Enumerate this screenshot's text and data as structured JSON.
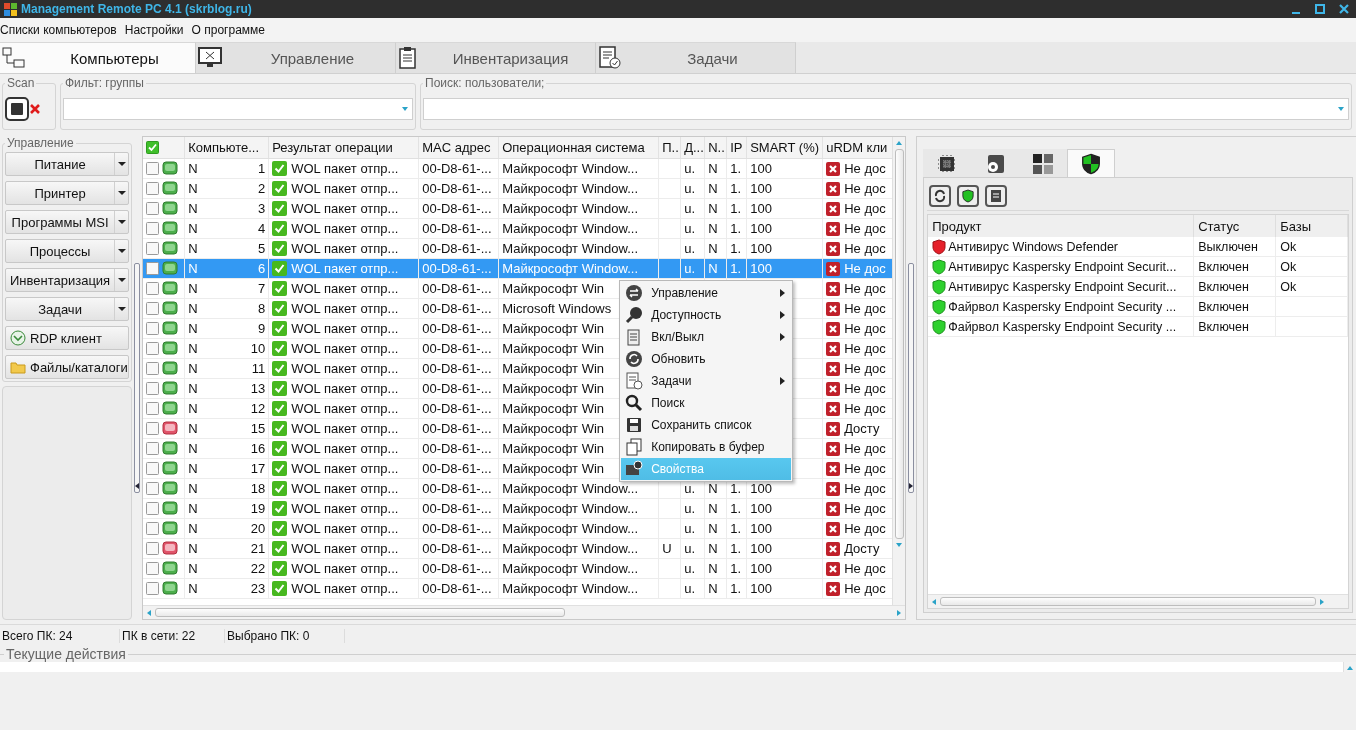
{
  "window": {
    "title": "Management Remote PC 4.1 (skrblog.ru)"
  },
  "menu": [
    "Списки компьютеров",
    "Настройки",
    "О программе"
  ],
  "tabs": [
    {
      "label": "Компьютеры",
      "selected": true
    },
    {
      "label": "Управление",
      "selected": false
    },
    {
      "label": "Инвентаризация",
      "selected": false
    },
    {
      "label": "Задачи",
      "selected": false
    }
  ],
  "scan": {
    "label": "Scan"
  },
  "filters": [
    {
      "label": "Фильт: группы"
    },
    {
      "label": "Поиск: пользователи;"
    }
  ],
  "sidebar": {
    "title": "Управление",
    "buttons": [
      {
        "label": "Питание",
        "dropdown": true
      },
      {
        "label": "Принтер",
        "dropdown": true
      },
      {
        "label": "Программы MSI",
        "dropdown": true
      },
      {
        "label": "Процессы",
        "dropdown": true
      },
      {
        "label": "Инвентаризация",
        "dropdown": true
      },
      {
        "label": "Задачи",
        "dropdown": true
      },
      {
        "label": "RDP клиент",
        "dropdown": false
      },
      {
        "label": "Файлы/каталоги",
        "dropdown": false
      }
    ]
  },
  "table": {
    "select_all": true,
    "columns": [
      "Компьюте...",
      "Результат операции",
      "MAC адрес",
      "Операционная система",
      "П..",
      "Д...",
      "N..",
      "IP",
      "SMART (%)",
      "uRDM кли"
    ],
    "rows": [
      {
        "checked": false,
        "online": true,
        "selected": false,
        "name": "N",
        "number": "1",
        "result": "WOL пакет отпр...",
        "mac": "00-D8-61-...",
        "os": "Майкрософт Window...",
        "d": "u.",
        "n": "N",
        "ip": "1.",
        "smart": "100",
        "urdm": "Не дос"
      },
      {
        "checked": false,
        "online": true,
        "selected": false,
        "name": "N",
        "number": "2",
        "result": "WOL пакет отпр...",
        "mac": "00-D8-61-...",
        "os": "Майкрософт Window...",
        "d": "u.",
        "n": "N",
        "ip": "1.",
        "smart": "100",
        "urdm": "Не дос"
      },
      {
        "checked": false,
        "online": true,
        "selected": false,
        "name": "N",
        "number": "3",
        "result": "WOL пакет отпр...",
        "mac": "00-D8-61-...",
        "os": "Майкрософт Window...",
        "d": "u.",
        "n": "N",
        "ip": "1.",
        "smart": "100",
        "urdm": "Не дос"
      },
      {
        "checked": false,
        "online": true,
        "selected": false,
        "name": "N",
        "number": "4",
        "result": "WOL пакет отпр...",
        "mac": "00-D8-61-...",
        "os": "Майкрософт Window...",
        "d": "u.",
        "n": "N",
        "ip": "1.",
        "smart": "100",
        "urdm": "Не дос"
      },
      {
        "checked": false,
        "online": true,
        "selected": false,
        "name": "N",
        "number": "5",
        "result": "WOL пакет отпр...",
        "mac": "00-D8-61-...",
        "os": "Майкрософт Window...",
        "d": "u.",
        "n": "N",
        "ip": "1.",
        "smart": "100",
        "urdm": "Не дос"
      },
      {
        "checked": false,
        "online": true,
        "selected": true,
        "name": "N",
        "number": "6",
        "result": "WOL пакет отпр...",
        "mac": "00-D8-61-...",
        "os": "Майкрософт Window...",
        "d": "u.",
        "n": "N",
        "ip": "1.",
        "smart": "100",
        "urdm": "Не дос"
      },
      {
        "checked": false,
        "online": true,
        "selected": false,
        "name": "N",
        "number": "7",
        "result": "WOL пакет отпр...",
        "mac": "00-D8-61-...",
        "os": "Майкрософт Win",
        "urdm": "Не дос"
      },
      {
        "checked": false,
        "online": true,
        "selected": false,
        "name": "N",
        "number": "8",
        "result": "WOL пакет отпр...",
        "mac": "00-D8-61-...",
        "os": "Microsoft Windows",
        "urdm": "Не дос"
      },
      {
        "checked": false,
        "online": true,
        "selected": false,
        "name": "N",
        "number": "9",
        "result": "WOL пакет отпр...",
        "mac": "00-D8-61-...",
        "os": "Майкрософт Win",
        "urdm": "Не дос"
      },
      {
        "checked": false,
        "online": true,
        "selected": false,
        "name": "N",
        "number": "10",
        "result": "WOL пакет отпр...",
        "mac": "00-D8-61-...",
        "os": "Майкрософт Win",
        "urdm": "Не дос"
      },
      {
        "checked": false,
        "online": true,
        "selected": false,
        "name": "N",
        "number": "11",
        "result": "WOL пакет отпр...",
        "mac": "00-D8-61-...",
        "os": "Майкрософт Win",
        "urdm": "Не дос"
      },
      {
        "checked": false,
        "online": true,
        "selected": false,
        "name": "N",
        "number": "13",
        "result": "WOL пакет отпр...",
        "mac": "00-D8-61-...",
        "os": "Майкрософт Win",
        "urdm": "Не дос"
      },
      {
        "checked": false,
        "online": true,
        "selected": false,
        "name": "N",
        "number": "12",
        "result": "WOL пакет отпр...",
        "mac": "00-D8-61-...",
        "os": "Майкрософт Win",
        "urdm": "Не дос"
      },
      {
        "checked": false,
        "online": false,
        "selected": false,
        "name": "N",
        "number": "15",
        "result": "WOL пакет отпр...",
        "mac": "00-D8-61-...",
        "os": "Майкрософт Win",
        "urdm": "Досту"
      },
      {
        "checked": false,
        "online": true,
        "selected": false,
        "name": "N",
        "number": "16",
        "result": "WOL пакет отпр...",
        "mac": "00-D8-61-...",
        "os": "Майкрософт Win",
        "urdm": "Не дос"
      },
      {
        "checked": false,
        "online": true,
        "selected": false,
        "name": "N",
        "number": "17",
        "result": "WOL пакет отпр...",
        "mac": "00-D8-61-...",
        "os": "Майкрософт Win",
        "urdm": "Не дос"
      },
      {
        "checked": false,
        "online": true,
        "selected": false,
        "name": "N",
        "number": "18",
        "result": "WOL пакет отпр...",
        "mac": "00-D8-61-...",
        "os": "Майкрософт Window...",
        "d": "u.",
        "n": "N",
        "ip": "1.",
        "smart": "100",
        "urdm": "Не дос"
      },
      {
        "checked": false,
        "online": true,
        "selected": false,
        "name": "N",
        "number": "19",
        "result": "WOL пакет отпр...",
        "mac": "00-D8-61-...",
        "os": "Майкрософт Window...",
        "d": "u.",
        "n": "N",
        "ip": "1.",
        "smart": "100",
        "urdm": "Не дос"
      },
      {
        "checked": false,
        "online": true,
        "selected": false,
        "name": "N",
        "number": "20",
        "result": "WOL пакет отпр...",
        "mac": "00-D8-61-...",
        "os": "Майкрософт Window...",
        "d": "u.",
        "n": "N",
        "ip": "1.",
        "smart": "100",
        "urdm": "Не дос"
      },
      {
        "checked": false,
        "online": false,
        "selected": false,
        "name": "N",
        "number": "21",
        "result": "WOL пакет отпр...",
        "mac": "00-D8-61-...",
        "os": "Майкрософт Window...",
        "p": "U",
        "d": "u.",
        "n": "N",
        "ip": "1.",
        "smart": "100",
        "urdm": "Досту"
      },
      {
        "checked": false,
        "online": true,
        "selected": false,
        "name": "N",
        "number": "22",
        "result": "WOL пакет отпр...",
        "mac": "00-D8-61-...",
        "os": "Майкрософт Window...",
        "d": "u.",
        "n": "N",
        "ip": "1.",
        "smart": "100",
        "urdm": "Не дос"
      },
      {
        "checked": false,
        "online": true,
        "selected": false,
        "name": "N",
        "number": "23",
        "result": "WOL пакет отпр...",
        "mac": "00-D8-61-...",
        "os": "Майкрософт Window...",
        "d": "u.",
        "n": "N",
        "ip": "1.",
        "smart": "100",
        "urdm": "Не дос"
      }
    ]
  },
  "context_menu": [
    {
      "label": "Управление",
      "submenu": true,
      "selected": false
    },
    {
      "label": "Доступность",
      "submenu": true,
      "selected": false
    },
    {
      "label": "Вкл/Выкл",
      "submenu": true,
      "selected": false
    },
    {
      "label": "Обновить",
      "submenu": false,
      "selected": false
    },
    {
      "label": "Задачи",
      "submenu": true,
      "selected": false
    },
    {
      "label": "Поиск",
      "submenu": false,
      "selected": false
    },
    {
      "label": "Сохранить список",
      "submenu": false,
      "selected": false
    },
    {
      "label": "Копировать в буфер",
      "submenu": false,
      "selected": false
    },
    {
      "label": "Свойства",
      "submenu": false,
      "selected": true
    }
  ],
  "right_panel": {
    "tabs": [
      {
        "selected": false
      },
      {
        "selected": false
      },
      {
        "selected": false
      },
      {
        "selected": true
      }
    ],
    "columns": [
      "Продукт",
      "Статус",
      "Базы"
    ],
    "rows": [
      {
        "name": "Антивирус Windows Defender",
        "enabled": false,
        "status": "Выключен",
        "bases": "Ok"
      },
      {
        "name": "Антивирус Kaspersky Endpoint Securit...",
        "enabled": true,
        "status": "Включен",
        "bases": "Ok"
      },
      {
        "name": "Антивирус Kaspersky Endpoint Securit...",
        "enabled": true,
        "status": "Включен",
        "bases": "Ok"
      },
      {
        "name": "Файрвол Kaspersky Endpoint Security ...",
        "enabled": true,
        "status": "Включен"
      },
      {
        "name": "Файрвол Kaspersky Endpoint Security ...",
        "enabled": true,
        "status": "Включен"
      }
    ]
  },
  "status_bar": [
    "Всего ПК: 24",
    "ПК в сети: 22",
    "Выбрано ПК: 0"
  ],
  "log": {
    "title": "Текущие действия"
  }
}
